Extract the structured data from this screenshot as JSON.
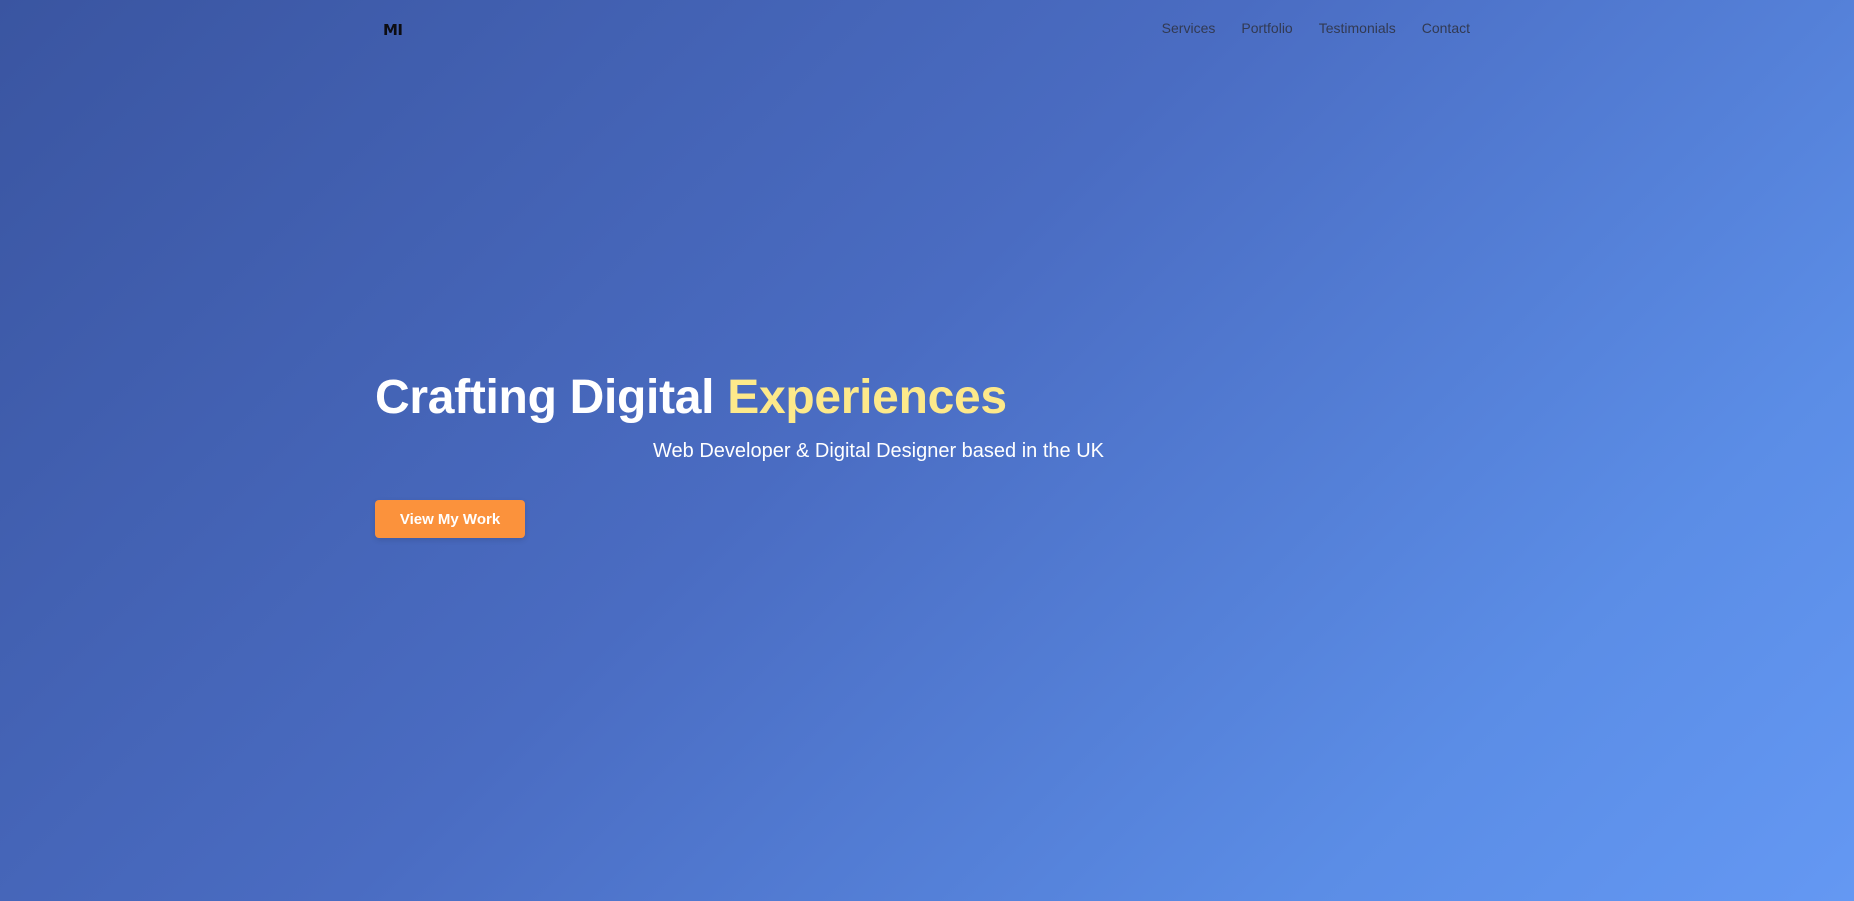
{
  "nav": {
    "logo": "MI",
    "links": [
      "Services",
      "Portfolio",
      "Testimonials",
      "Contact"
    ]
  },
  "hero": {
    "title_main": "Crafting Digital ",
    "title_accent": "Experiences",
    "subtitle": "Web Developer & Digital Designer based in the UK",
    "cta_label": "View My Work"
  },
  "colors": {
    "accent_text": "#fde98a",
    "cta_background": "#fb923c",
    "background_gradient_start": "#3a55a1",
    "background_gradient_end": "#6498f3"
  }
}
